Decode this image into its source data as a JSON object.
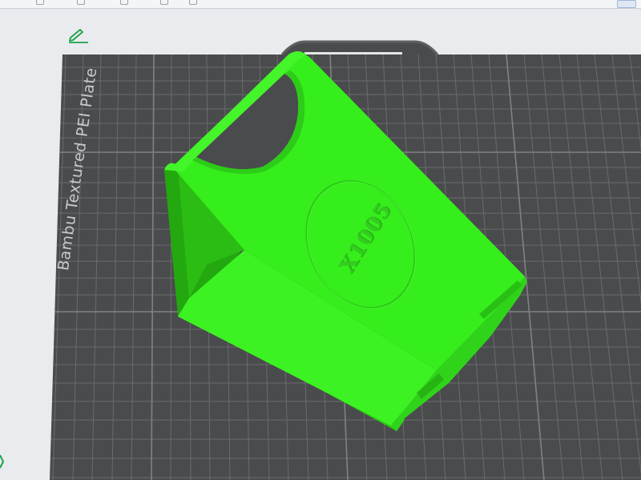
{
  "app": {
    "accent_color": "#00a300"
  },
  "toolbar": {
    "icons": [
      "move-icon",
      "rotate-icon",
      "cut-icon",
      "layer-icon",
      "view-icon"
    ],
    "right_icon": "window-icon"
  },
  "object_edit": {
    "icon": "pencil-icon"
  },
  "build_plate": {
    "label": "Bambu Textured PEI Plate",
    "plate_color": "#4a4b4d",
    "grid_color": "#6a6b6d"
  },
  "model": {
    "stamp_text": "X1005",
    "color": "#35ee1c"
  }
}
